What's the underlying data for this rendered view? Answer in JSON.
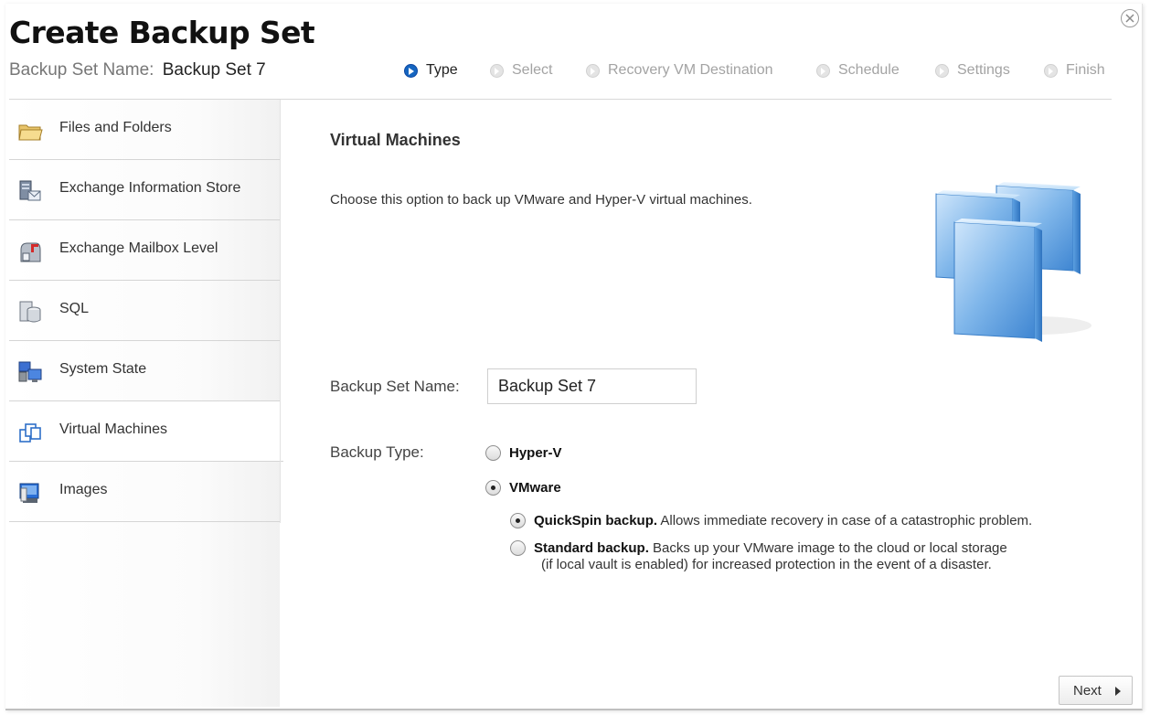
{
  "header": {
    "title": "Create Backup Set",
    "set_name_label": "Backup Set Name:",
    "set_name_value": "Backup Set 7"
  },
  "steps": [
    {
      "label": "Type",
      "state": "active"
    },
    {
      "label": "Select",
      "state": "inactive"
    },
    {
      "label": "Recovery VM Destination",
      "state": "inactive"
    },
    {
      "label": "Schedule",
      "state": "inactive"
    },
    {
      "label": "Settings",
      "state": "inactive"
    },
    {
      "label": "Finish",
      "state": "inactive"
    }
  ],
  "sidebar": {
    "items": [
      {
        "label": "Files and Folders",
        "icon": "folder-icon"
      },
      {
        "label": "Exchange Information Store",
        "icon": "exchange-store-icon"
      },
      {
        "label": "Exchange Mailbox Level",
        "icon": "mailbox-icon"
      },
      {
        "label": "SQL",
        "icon": "database-icon"
      },
      {
        "label": "System State",
        "icon": "system-state-icon"
      },
      {
        "label": "Virtual Machines",
        "icon": "virtual-machines-icon",
        "selected": true
      },
      {
        "label": "Images",
        "icon": "images-icon"
      }
    ]
  },
  "main": {
    "heading": "Virtual Machines",
    "description": "Choose this option to back up VMware and Hyper-V virtual machines.",
    "name_label": "Backup Set Name:",
    "name_value": "Backup Set 7",
    "type_label": "Backup Type:",
    "options": {
      "hyperv": {
        "label": "Hyper-V",
        "checked": false
      },
      "vmware": {
        "label": "VMware",
        "checked": true
      },
      "quickspin": {
        "title": "QuickSpin backup.",
        "desc": "Allows immediate recovery in case of a catastrophic problem.",
        "checked": true
      },
      "standard": {
        "title": "Standard backup.",
        "desc": "Backs up your VMware image to the cloud or local storage",
        "desc2": "(if local vault is enabled) for increased protection in the event of a disaster.",
        "checked": false
      }
    }
  },
  "footer": {
    "next_label": "Next"
  },
  "colors": {
    "accent": "#1565c0",
    "inactive_step": "#a3a3a3",
    "text": "#333333"
  }
}
